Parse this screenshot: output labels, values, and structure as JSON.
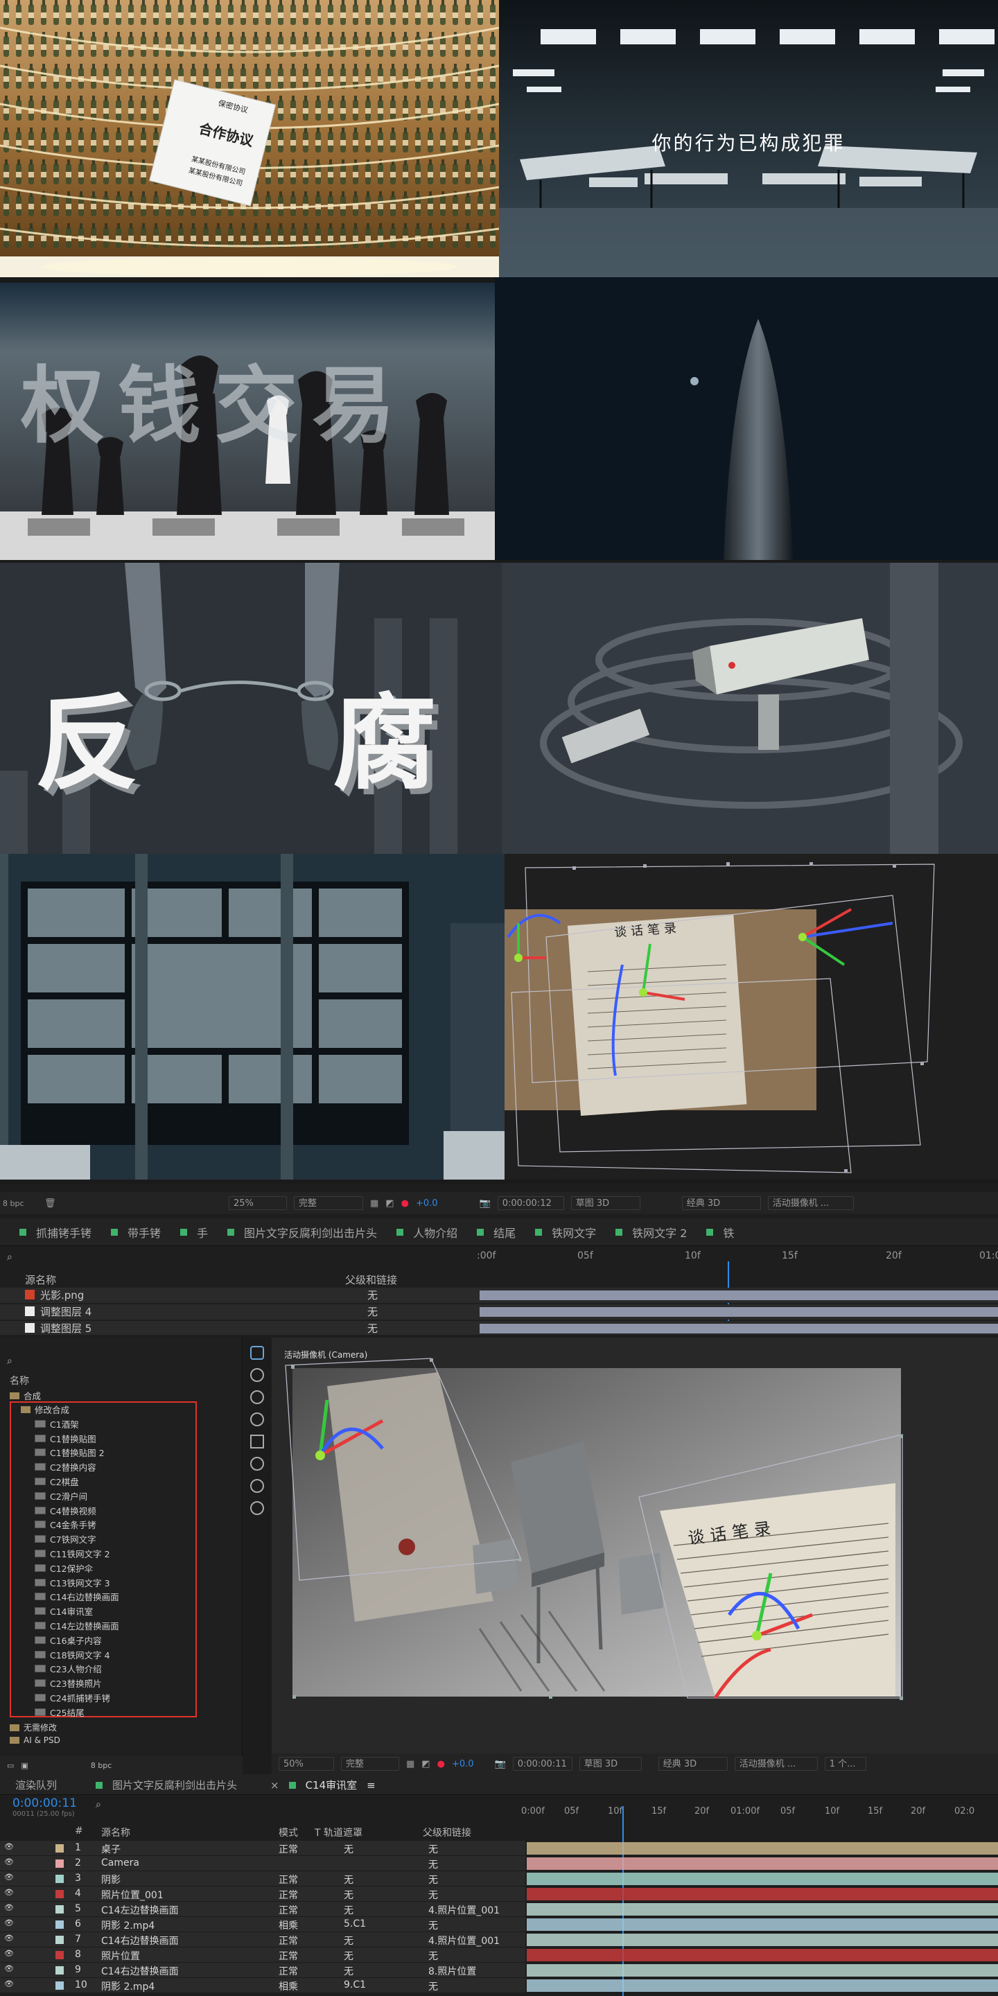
{
  "scenes": {
    "contract": {
      "title": "保密协议",
      "doc_title": "合作协议",
      "lines": [
        "某某股份有限公司",
        "某某股份有限公司"
      ]
    },
    "morgue": {
      "subtitle": "你的行为已构成犯罪"
    },
    "chess": {
      "text": "权钱交易"
    },
    "anticorrupt": {
      "left": "反",
      "right": "腐"
    },
    "doc_editor": {
      "title": "谈话笔录"
    }
  },
  "viewer_toolbar": {
    "bpc": "8 bpc",
    "zoom": "25%",
    "quality": "完整",
    "exposure": "+0.0",
    "time": "0:00:00:12",
    "draft": "草图 3D",
    "renderer": "经典 3D",
    "camera": "活动摄像机 ..."
  },
  "comp_tabs": [
    "抓捕铐手铐",
    "带手铐",
    "手",
    "图片文字反腐利剑出击片头",
    "人物介绍",
    "结尾",
    "铁网文字",
    "铁网文字 2",
    "铁"
  ],
  "top_timeline": {
    "col_source": "源名称",
    "col_parent": "父级和链接",
    "ticks": [
      ":00f",
      "05f",
      "10f",
      "15f",
      "20f",
      "01:0"
    ],
    "rows": [
      {
        "name": "光影.png",
        "parent": "无"
      },
      {
        "name": "调整图层 4",
        "parent": "无"
      },
      {
        "name": "调整图层 5",
        "parent": "无"
      }
    ]
  },
  "project": {
    "col_name": "名称",
    "root": "合成",
    "folder": "修改合成",
    "items": [
      "C1酒架",
      "C1替换贴图",
      "C1替换贴图 2",
      "C2替换内容",
      "C2棋盘",
      "C2滑户间",
      "C4替换视频",
      "C4金条手铐",
      "C7铁网文字",
      "C11铁网文字 2",
      "C12保护伞",
      "C13铁网文字 3",
      "C14右边替换画面",
      "C14审讯室",
      "C14左边替换画面",
      "C16桌子内容",
      "C18铁网文字 4",
      "C23人物介绍",
      "C23替换照片",
      "C24抓捕铐手铐",
      "C25结尾"
    ],
    "other_folder": "无需修改",
    "other_folder2": "AI & PSD",
    "bpc": "8 bpc"
  },
  "comp_viewer": {
    "label": "活动摄像机 (Camera)",
    "doc_title": "谈话笔录",
    "zoom": "50%",
    "quality": "完整",
    "exposure": "+0.0",
    "time": "0:00:00:11",
    "draft": "草图 3D",
    "renderer": "经典 3D",
    "camera": "活动摄像机 ...",
    "views": "1 个..."
  },
  "bottom_tabs": {
    "render": "渲染队列",
    "tab1": "图片文字反腐利剑出击片头",
    "tab2": "C14审讯室"
  },
  "bottom_timeline": {
    "timecode": "0:00:00:11",
    "fps": "00011 (25.00 fps)",
    "col_num": "#",
    "col_source": "源名称",
    "col_mode": "模式",
    "col_track": "T 轨道遮罩",
    "col_parent": "父级和链接",
    "ticks": [
      "0:00f",
      "05f",
      "10f",
      "15f",
      "20f",
      "01:00f",
      "05f",
      "10f",
      "15f",
      "20f",
      "02:0"
    ],
    "layers": [
      {
        "num": "1",
        "name": "桌子",
        "mode": "正常",
        "track": "无",
        "parent": "无",
        "color": "#c9b48a"
      },
      {
        "num": "2",
        "name": "Camera",
        "mode": "",
        "track": "",
        "parent": "无",
        "color": "#e5a3a3"
      },
      {
        "num": "3",
        "name": "阴影",
        "mode": "正常",
        "track": "无",
        "parent": "无",
        "color": "#9fd1c8"
      },
      {
        "num": "4",
        "name": "照片位置_001",
        "mode": "正常",
        "track": "无",
        "parent": "无",
        "color": "#c53a3a"
      },
      {
        "num": "5",
        "name": "C14左边替换画面",
        "mode": "正常",
        "track": "无",
        "parent": "4.照片位置_001",
        "color": "#b9d6cf"
      },
      {
        "num": "6",
        "name": "阴影 2.mp4",
        "mode": "相乘",
        "track": "5.C1",
        "parent": "无",
        "color": "#a7c9d9"
      },
      {
        "num": "7",
        "name": "C14右边替换画面",
        "mode": "正常",
        "track": "无",
        "parent": "4.照片位置_001",
        "color": "#b9d6cf"
      },
      {
        "num": "8",
        "name": "照片位置",
        "mode": "正常",
        "track": "无",
        "parent": "无",
        "color": "#c53a3a"
      },
      {
        "num": "9",
        "name": "C14右边替换画面",
        "mode": "正常",
        "track": "无",
        "parent": "8.照片位置",
        "color": "#b9d6cf"
      },
      {
        "num": "10",
        "name": "阴影 2.mp4",
        "mode": "相乘",
        "track": "9.C1",
        "parent": "无",
        "color": "#a7c9d9"
      }
    ]
  },
  "colors": {
    "accent_blue": "#2d8ceb",
    "selection_red": "#e0322a",
    "layer_green": "#3fb36b"
  }
}
